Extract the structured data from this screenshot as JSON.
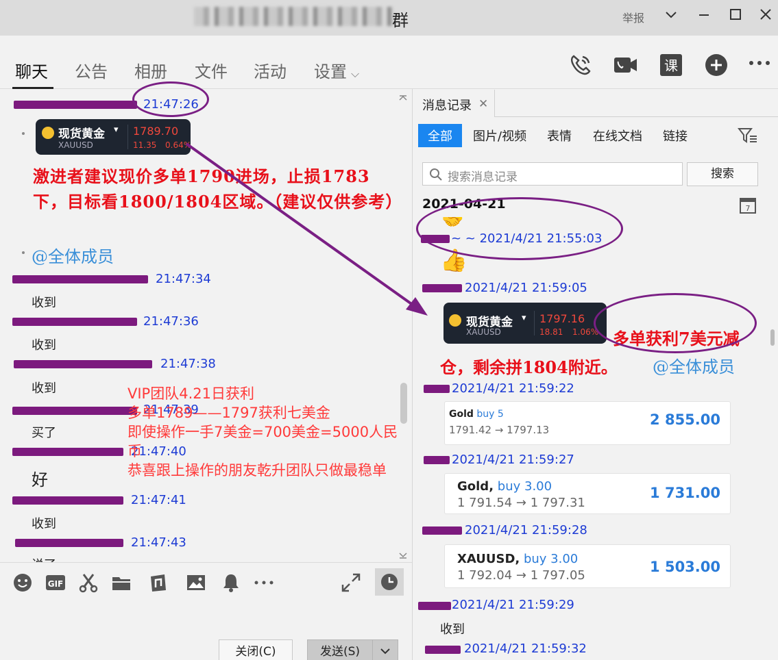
{
  "window": {
    "title_suffix": "群",
    "report_label": "举报"
  },
  "tabs": [
    {
      "label": "聊天"
    },
    {
      "label": "公告"
    },
    {
      "label": "相册"
    },
    {
      "label": "文件"
    },
    {
      "label": "活动"
    },
    {
      "label": "设置"
    }
  ],
  "chat": {
    "messages": [
      {
        "time": "21:47:26"
      },
      {
        "time": "21:47:34",
        "text": "收到"
      },
      {
        "time": "21:47:36",
        "text": "收到"
      },
      {
        "time": "21:47:38",
        "text": "收到"
      },
      {
        "time": "21:47:39",
        "text": "买了"
      },
      {
        "time": "21:47:40",
        "text": "好"
      },
      {
        "time": "21:47:41",
        "text": "收到"
      },
      {
        "time": "21:47:43",
        "text": "说了"
      }
    ],
    "quote_card": {
      "name": "现货黄金",
      "symbol": "XAUUSD",
      "price": "1789.70",
      "change": "11.35",
      "change_pct": "0.64%"
    },
    "advice_text": "激进者建议现价多单1790进场，止损1783下，目标看1800/1804区域。（建议仅供参考）",
    "mention": "@全体成员",
    "vip_lines": [
      "VIP团队4.21日获利",
      "多单1789——1797获利七美金",
      "即使操作一手7美金=700美金=5000人民币",
      "恭喜跟上操作的朋友乾升团队只做最稳单"
    ]
  },
  "composer": {
    "close_label": "关闭(C)",
    "send_label": "发送(S)"
  },
  "history": {
    "tab_label": "消息记录",
    "filters": [
      "全部",
      "图片/视频",
      "表情",
      "在线文档",
      "链接"
    ],
    "search_placeholder": "搜索消息记录",
    "search_button": "搜索",
    "date_header": "2021-04-21",
    "times": [
      "~ ~ 2021/4/21 21:55:03",
      "2021/4/21 21:59:05",
      "2021/4/21 21:59:22",
      "2021/4/21 21:59:27",
      "2021/4/21 21:59:28",
      "2021/4/21 21:59:29",
      "2021/4/21 21:59:32"
    ],
    "quote_card": {
      "name": "现货黄金",
      "symbol": "XAUUSD",
      "price": "1797.16",
      "change": "18.81",
      "change_pct": "1.06%"
    },
    "result_line1": "多单获利7美元减",
    "result_line2": "仓，剩余拼1804附近。",
    "mention": "@全体成员",
    "trades": [
      {
        "symbol": "Gold",
        "side": "buy 5",
        "open": "1791.42",
        "close": "1797.13",
        "profit": "2 855.00"
      },
      {
        "symbol": "Gold,",
        "side": "buy 3.00",
        "open": "1 791.54",
        "close": "1 797.31",
        "profit": "1 731.00"
      },
      {
        "symbol": "XAUUSD,",
        "side": "buy 3.00",
        "open": "1 792.04",
        "close": "1 797.05",
        "profit": "1 503.00"
      }
    ],
    "last_text": "收到"
  },
  "colors": {
    "accent": "#1a86f0",
    "time_blue": "#1d3bd4",
    "highlight_red": "#e8101a",
    "annotation_purple": "#7a1f84",
    "mention_blue": "#3a8fd8"
  }
}
